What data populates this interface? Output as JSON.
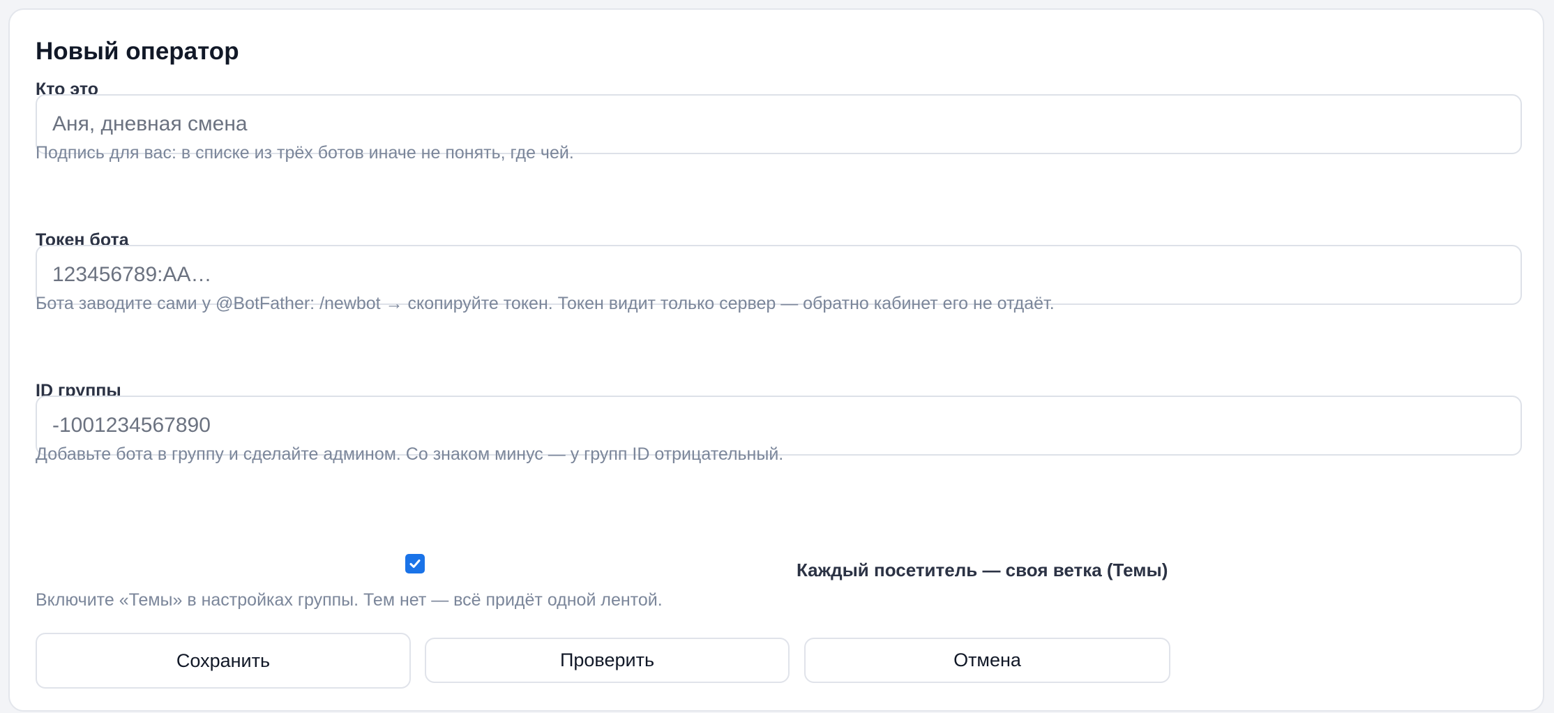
{
  "form": {
    "title": "Новый оператор",
    "fields": [
      {
        "label": "Кто это",
        "value": "",
        "placeholder": "Аня, дневная смена",
        "hint": "Подпись для вас: в списке из трёх ботов иначе не понять, где чей."
      },
      {
        "label": "Токен бота",
        "value": "",
        "placeholder": "123456789:AA…",
        "hint": "Бота заводите сами у @BotFather: /newbot → скопируйте токен. Токен видит только сервер — обратно кабинет его не отдаёт."
      },
      {
        "label": "ID группы",
        "value": "",
        "placeholder": "-1001234567890",
        "hint": "Добавьте бота в группу и сделайте админом. Со знаком минус — у групп ID отрицательный."
      }
    ],
    "topics": {
      "checked": true,
      "label": "Каждый посетитель — своя ветка (Темы)",
      "hint": "Включите «Темы» в настройках группы. Тем нет — всё придёт одной лентой."
    },
    "buttons": {
      "save": "Сохранить",
      "check": "Проверить",
      "cancel": "Отмена"
    }
  },
  "colors": {
    "accent": "#1a73e8",
    "hint_text": "#7b869a",
    "border": "#dde1e8"
  },
  "icons": {
    "checkbox": "checkmark-icon"
  }
}
